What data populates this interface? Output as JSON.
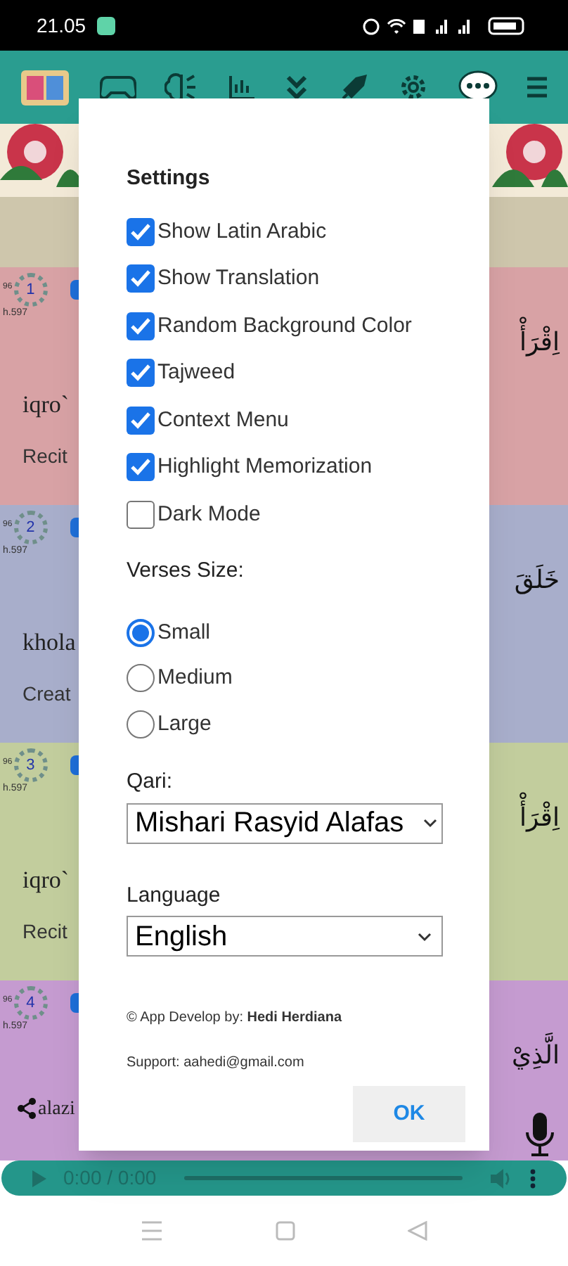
{
  "status_bar": {
    "time": "21.05"
  },
  "verses": [
    {
      "number": "1",
      "ref": "96",
      "page": "h.597",
      "latin": "iqro`",
      "translation": "Recit",
      "arabic": "اِقْرَأْ",
      "color": "#d8a2a5"
    },
    {
      "number": "2",
      "ref": "96",
      "page": "h.597",
      "latin": "khola",
      "translation": "Creat",
      "arabic": "خَلَقَ",
      "color": "#a8aecb"
    },
    {
      "number": "3",
      "ref": "96",
      "page": "h.597",
      "latin": "iqro`",
      "translation": "Recit",
      "arabic": "اِقْرَأْ",
      "color": "#c2cd9d"
    },
    {
      "number": "4",
      "ref": "96",
      "page": "h.597",
      "latin": "alazi",
      "arabic": "الَّذِيْ",
      "color": "#c59bd0"
    }
  ],
  "dialog": {
    "title": "Settings",
    "options": [
      {
        "label": "Show Latin Arabic",
        "checked": true
      },
      {
        "label": "Show Translation",
        "checked": true
      },
      {
        "label": "Random Background Color",
        "checked": true
      },
      {
        "label": "Tajweed",
        "checked": true
      },
      {
        "label": "Context Menu",
        "checked": true
      },
      {
        "label": "Highlight Memorization",
        "checked": true
      },
      {
        "label": "Dark Mode",
        "checked": false
      }
    ],
    "verses_size": {
      "label": "Verses Size:",
      "options": [
        {
          "label": "Small",
          "selected": true
        },
        {
          "label": "Medium",
          "selected": false
        },
        {
          "label": "Large",
          "selected": false
        }
      ]
    },
    "qari": {
      "label": "Qari:",
      "value": "Mishari Rasyid Alafas"
    },
    "language": {
      "label": "Language",
      "value": "English"
    },
    "credit": "© App Develop by: **Hedi Herdiana**",
    "support": "Support: aahedi@gmail.com",
    "ok_button": "OK"
  },
  "audio_player": {
    "time": "0:00 / 0:00"
  }
}
